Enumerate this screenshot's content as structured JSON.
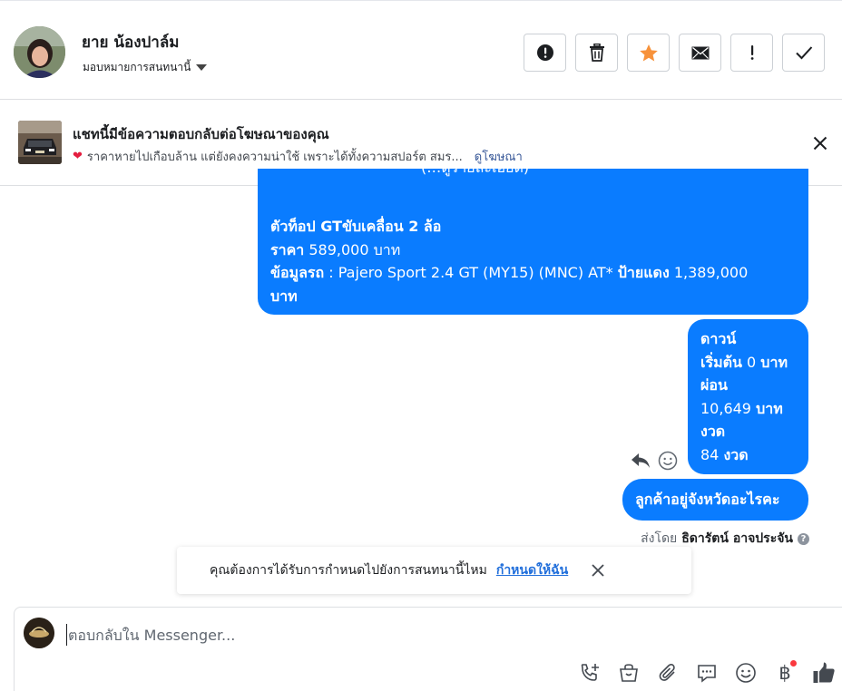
{
  "header": {
    "contact_name": "ยาย น้องปาล์ม",
    "assign_label": "มอบหมายการสนทนานี้",
    "actions": [
      {
        "name": "mark-spam-button",
        "icon": "exclamation-circle-icon"
      },
      {
        "name": "delete-button",
        "icon": "trash-icon"
      },
      {
        "name": "star-button",
        "icon": "star-icon"
      },
      {
        "name": "mark-unread-button",
        "icon": "envelope-icon"
      },
      {
        "name": "follow-up-button",
        "icon": "exclamation-icon"
      },
      {
        "name": "mark-done-button",
        "icon": "check-icon"
      }
    ],
    "star_color": "#f7923b"
  },
  "ad_banner": {
    "title": "แชทนี้มีข้อความตอบกลับต่อโฆษณาของคุณ",
    "description": "ราคาหายไปเกือบล้าน แต่ยังคงความน่าใช้ เพราะได้ทั้งความสปอร์ต สมร...",
    "link": "ดูโฆษณา",
    "heart_icon": "heart-icon"
  },
  "messages": {
    "bubble_color": "#0a7cff",
    "msg1": {
      "cut_top": "(…ดูรายละเอียด)",
      "line1": " ตัวท็อป GTขับเคลื่อน 2 ล้อ",
      "price_label": "ราคา",
      "price_value": " 589,000 บาท",
      "info_label": "ข้อมูลรถ",
      "info_value": " : Pajero Sport 2.4 GT (MY15) (MNC) AT* ",
      "plate_label": "ป้ายแดง",
      "plate_value": " 1,389,000",
      "tail": "บาท"
    },
    "msg2": {
      "l1": "ดาวน์",
      "l2a": "เริ่มต้น",
      "l2b": " 0 ",
      "l2c": "บาท",
      "l3": "ผ่อน",
      "l4a": "10,649 ",
      "l4b": "บาท",
      "l5": "งวด",
      "l6a": "84 ",
      "l6b": "งวด"
    },
    "msg3": "ลูกค้าอยู่จังหวัดอะไรคะ",
    "sent_by_label": "ส่งโดย",
    "sent_by_name": "ธิดารัตน์ อาจประจัน"
  },
  "toast": {
    "text": "คุณต้องการได้รับการกำหนดไปยังการสนทนานี้ไหม",
    "link": "กำหนดให้ฉัน"
  },
  "composer": {
    "placeholder": "ตอบกลับใน Messenger...",
    "tools": [
      "call-add-icon",
      "shopping-bag-icon",
      "paperclip-icon",
      "saved-reply-icon",
      "emoji-icon",
      "baht-payment-icon",
      "like-icon"
    ]
  }
}
